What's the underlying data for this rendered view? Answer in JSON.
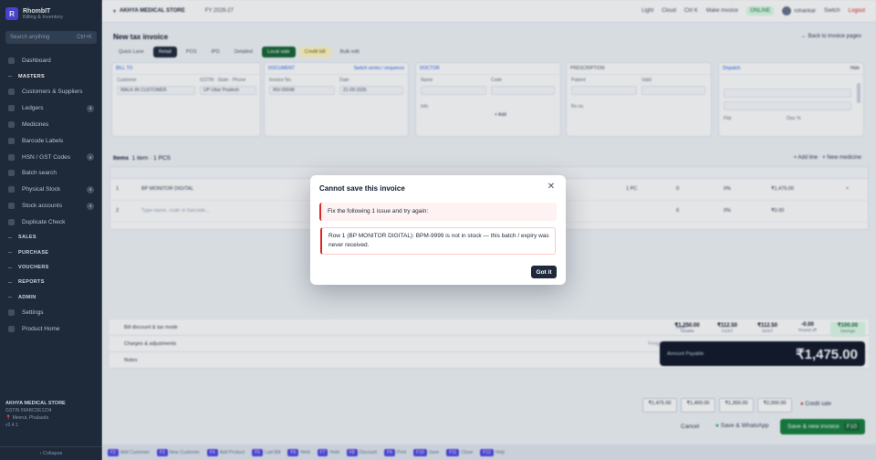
{
  "sidebar": {
    "brand_name": "RhombIT",
    "brand_sub": "Billing & Inventory",
    "search_placeholder": "Search anything",
    "search_shortcut": "Ctrl+K",
    "items": [
      {
        "label": "Dashboard",
        "type": "item"
      },
      {
        "label": "MASTERS",
        "type": "section"
      },
      {
        "label": "Customers & Suppliers",
        "type": "item"
      },
      {
        "label": "Ledgers",
        "type": "item",
        "badge": "4"
      },
      {
        "label": "Medicines",
        "type": "item"
      },
      {
        "label": "Barcode Labels",
        "type": "item"
      },
      {
        "label": "HSN / GST Codes",
        "type": "item",
        "badge": "4"
      },
      {
        "label": "Batch search",
        "type": "item"
      },
      {
        "label": "Physical Stock",
        "type": "item",
        "badge": "4"
      },
      {
        "label": "Stock accounts",
        "type": "item",
        "badge": "4"
      },
      {
        "label": "Duplicate Check",
        "type": "item"
      },
      {
        "label": "SALES",
        "type": "section"
      },
      {
        "label": "PURCHASE",
        "type": "section"
      },
      {
        "label": "VOUCHERS",
        "type": "section"
      },
      {
        "label": "REPORTS",
        "type": "section"
      },
      {
        "label": "ADMIN",
        "type": "section"
      },
      {
        "label": "Settings",
        "type": "item"
      },
      {
        "label": "Product Home",
        "type": "item"
      }
    ],
    "footer_store": "AKHYA MEDICAL STORE",
    "footer_gst": "GSTIN 09ABCDE1234",
    "footer_location": "Meerut, Phalauda",
    "footer_version": "v2.4.1",
    "collapse_label": "Collapse"
  },
  "topbar": {
    "store": "AKHYA MEDICAL STORE",
    "fy": "FY 2026-27",
    "items": [
      "Light",
      "Cloud",
      "Ctrl K",
      "Make invoice"
    ],
    "sync_status": "ONLINE",
    "user": "rohankar",
    "user_switch": "Switch",
    "logout": "Logout"
  },
  "page": {
    "title": "New tax invoice",
    "back_link": "Back to invoice pages",
    "tabs": [
      {
        "label": "Quick Lane",
        "style": "plain"
      },
      {
        "label": "Retail",
        "style": "on"
      },
      {
        "label": "POS",
        "style": "plain"
      },
      {
        "label": "IPD",
        "style": "plain"
      },
      {
        "label": "Detailed",
        "style": "plain"
      },
      {
        "label": "Local sale",
        "style": "green"
      },
      {
        "label": "Credit bill",
        "style": "yellow"
      },
      {
        "label": "Bulk edit",
        "style": "plain"
      }
    ]
  },
  "cards": {
    "bill_to": {
      "header": "BILL TO",
      "label1": "Customer",
      "value1": "WALK-IN CUSTOMER",
      "label2": "GSTIN · State · Phone",
      "value2": "UP Uttar Pradesh"
    },
    "document": {
      "header": "DOCUMENT",
      "link": "Switch series / sequence",
      "label1": "Invoice No.",
      "value1": "INV-00048",
      "label2": "Date",
      "value2": "21-09-2026"
    },
    "doctor": {
      "header": "DOCTOR",
      "label1": "Name",
      "label2": "Code",
      "label3": "Info",
      "add": "+ Add"
    },
    "prescription": {
      "header": "PRESCRIPTION",
      "label1": "Patient",
      "label2": "Valid",
      "label3": "Rx no."
    },
    "dispatch": {
      "header": "Dispatch",
      "link": "Hide",
      "label1": "Flat",
      "label2": "Disc %"
    }
  },
  "items_table": {
    "heading": "Items",
    "count": "1 item · 1 PCS",
    "actions": [
      "+ Add line",
      "+ New medicine"
    ],
    "rows": [
      {
        "index": "1",
        "name": "BP MONITOR DIGITAL",
        "qty": "1 PC",
        "free": "0",
        "disc": "0%",
        "amount": "₹1,475.00",
        "del": "×"
      },
      {
        "index": "2",
        "name": "Type name, code or barcode...",
        "qty": "",
        "free": "0",
        "disc": "0%",
        "amount": "₹0.00",
        "del": ""
      }
    ]
  },
  "summary": {
    "lines": [
      {
        "label": "Bill discount & tax mode",
        "right": "Auto"
      },
      {
        "label": "Charges & adjustments",
        "right": "Freight, round off"
      },
      {
        "label": "Notes",
        "right": "Optional"
      }
    ],
    "stats": [
      {
        "value": "₹1,250.00",
        "label": "Taxable",
        "style": "plain"
      },
      {
        "value": "₹112.50",
        "label": "CGST",
        "style": "plain"
      },
      {
        "value": "₹112.50",
        "label": "SGST",
        "style": "plain"
      },
      {
        "value": "-0.00",
        "label": "Round off",
        "style": "plain"
      },
      {
        "value": "₹100.00",
        "label": "Savings",
        "style": "green"
      }
    ],
    "grand_label": "Amount Payable",
    "grand_total": "₹1,475.00",
    "payments": [
      "₹1,475.00",
      "₹1,400.00",
      "₹1,300.00",
      "₹2,000.00"
    ],
    "credit_label": "Credit sale",
    "cancel_label": "Cancel",
    "whatsapp_label": "Save & WhatsApp",
    "save_label": "Save & new invoice",
    "save_shortcut": "F10"
  },
  "hotkeys": [
    {
      "key": "F2",
      "label": "Add Customer"
    },
    {
      "key": "F3",
      "label": "New Customer"
    },
    {
      "key": "F4",
      "label": "Add Product"
    },
    {
      "key": "F5",
      "label": "Last Bill"
    },
    {
      "key": "F6",
      "label": "Held"
    },
    {
      "key": "F7",
      "label": "Hold"
    },
    {
      "key": "F8",
      "label": "Discount"
    },
    {
      "key": "F9",
      "label": "Print"
    },
    {
      "key": "F10",
      "label": "Save"
    },
    {
      "key": "F11",
      "label": "Close"
    },
    {
      "key": "F12",
      "label": "Help"
    }
  ],
  "dialog": {
    "title": "Cannot save this invoice",
    "alert": "Fix the following 1 issue and try again:",
    "issue": "Row 1 (BP MONITOR DIGITAL): BPM-9999 is not in stock — this batch / expiry was never received.",
    "button": "Got it"
  }
}
